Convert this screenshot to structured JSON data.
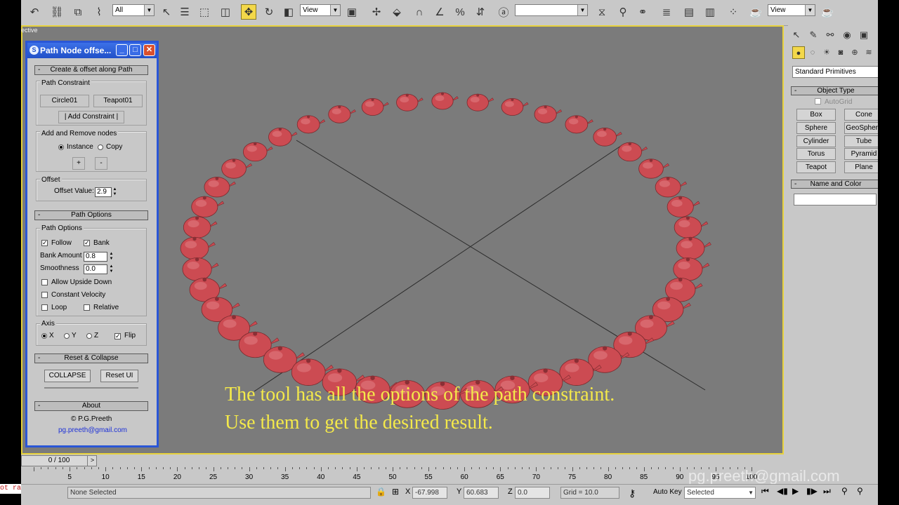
{
  "toolbar": {
    "selection_filter": "All",
    "ref_coord": "View",
    "named_selection": "",
    "render_view": "View"
  },
  "viewport": {
    "label": "ective",
    "caption_line1": "The tool has all the options of the path constraint.",
    "caption_line2": "Use them to get the desired result."
  },
  "dialog": {
    "title": "Path Node offse...",
    "rollout_create": "Create & offset along Path",
    "group_path_constraint": "Path Constraint",
    "btn_circle": "Circle01",
    "btn_teapot": "Teapot01",
    "btn_add_constraint": "| Add Constraint |",
    "group_add_remove": "Add and Remove nodes",
    "radio_instance": "Instance",
    "radio_copy": "Copy",
    "btn_plus": "+",
    "btn_minus": "-",
    "group_offset": "Offset",
    "offset_label": "Offset Value:",
    "offset_value": "2.9",
    "rollout_path_options": "Path Options",
    "group_path_options": "Path Options",
    "follow_label": "Follow",
    "follow_checked": true,
    "bank_label": "Bank",
    "bank_checked": true,
    "bank_amount_label": "Bank Amount",
    "bank_amount_value": "0.8",
    "smoothness_label": "Smoothness",
    "smoothness_value": "0.0",
    "allow_upside_down": "Allow Upside Down",
    "constant_velocity": "Constant Velocity",
    "loop_label": "Loop",
    "relative_label": "Relative",
    "group_axis": "Axis",
    "axis_x": "X",
    "axis_y": "Y",
    "axis_z": "Z",
    "flip_label": "Flip",
    "flip_checked": true,
    "rollout_reset": "Reset & Collapse",
    "btn_collapse": "COLLAPSE",
    "btn_reset_ui": "Reset UI",
    "rollout_about": "About",
    "about_credit": "© P.G.Preeth",
    "about_email": "pg.preeth@gmail.com"
  },
  "command_panel": {
    "category": "Standard Primitives",
    "rollout_object_type": "Object Type",
    "autogrid": "AutoGrid",
    "buttons": [
      "Box",
      "Cone",
      "Sphere",
      "GeoSphere",
      "Cylinder",
      "Tube",
      "Torus",
      "Pyramid",
      "Teapot",
      "Plane"
    ],
    "rollout_name_color": "Name and Color"
  },
  "timeline": {
    "slider": "0 / 100",
    "ticks": [
      "5",
      "10",
      "15",
      "20",
      "25",
      "30",
      "35",
      "40",
      "45",
      "50",
      "55",
      "60",
      "65",
      "70",
      "75",
      "80",
      "85",
      "90",
      "95",
      "100"
    ],
    "watermark": "pg.preeth@gmail.com"
  },
  "status": {
    "listener": "ot radius",
    "selection": "None Selected",
    "x_label": "X",
    "x_value": "-67.998",
    "y_label": "Y",
    "y_value": "60.683",
    "z_label": "Z",
    "z_value": "0.0",
    "grid": "Grid = 10.0",
    "auto_key": "Auto Key",
    "key_mode": "Selected"
  },
  "colors": {
    "viewport_bg": "#7b7b7b",
    "active_border": "#e7d23c",
    "caption": "#f4e94a",
    "teapot": "#cc4b52",
    "dialog_border": "#2a56d6"
  }
}
